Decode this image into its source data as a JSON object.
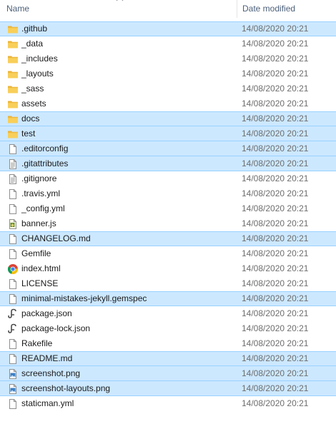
{
  "header": {
    "name_label": "Name",
    "date_label": "Date modified",
    "sort": "ascending"
  },
  "colors": {
    "selection_bg": "#cce8ff",
    "selection_border": "#99d1ff",
    "folder": "#f8c84b",
    "header_text": "#4c607a",
    "date_text": "#6d6d6d"
  },
  "files": [
    {
      "name": ".github",
      "date": "14/08/2020 20:21",
      "icon": "folder-icon",
      "selected": true
    },
    {
      "name": "_data",
      "date": "14/08/2020 20:21",
      "icon": "folder-icon",
      "selected": false
    },
    {
      "name": "_includes",
      "date": "14/08/2020 20:21",
      "icon": "folder-icon",
      "selected": false
    },
    {
      "name": "_layouts",
      "date": "14/08/2020 20:21",
      "icon": "folder-icon",
      "selected": false
    },
    {
      "name": "_sass",
      "date": "14/08/2020 20:21",
      "icon": "folder-icon",
      "selected": false
    },
    {
      "name": "assets",
      "date": "14/08/2020 20:21",
      "icon": "folder-icon",
      "selected": false
    },
    {
      "name": "docs",
      "date": "14/08/2020 20:21",
      "icon": "folder-icon",
      "selected": true
    },
    {
      "name": "test",
      "date": "14/08/2020 20:21",
      "icon": "folder-icon",
      "selected": true
    },
    {
      "name": ".editorconfig",
      "date": "14/08/2020 20:21",
      "icon": "file-icon",
      "selected": true
    },
    {
      "name": ".gitattributes",
      "date": "14/08/2020 20:21",
      "icon": "text-file-icon",
      "selected": true
    },
    {
      "name": ".gitignore",
      "date": "14/08/2020 20:21",
      "icon": "text-file-icon",
      "selected": false
    },
    {
      "name": ".travis.yml",
      "date": "14/08/2020 20:21",
      "icon": "file-icon",
      "selected": false
    },
    {
      "name": "_config.yml",
      "date": "14/08/2020 20:21",
      "icon": "file-icon",
      "selected": false
    },
    {
      "name": "banner.js",
      "date": "14/08/2020 20:21",
      "icon": "script-file-icon",
      "selected": false
    },
    {
      "name": "CHANGELOG.md",
      "date": "14/08/2020 20:21",
      "icon": "file-icon",
      "selected": true
    },
    {
      "name": "Gemfile",
      "date": "14/08/2020 20:21",
      "icon": "file-icon",
      "selected": false
    },
    {
      "name": "index.html",
      "date": "14/08/2020 20:21",
      "icon": "chrome-icon",
      "selected": false
    },
    {
      "name": "LICENSE",
      "date": "14/08/2020 20:21",
      "icon": "file-icon",
      "selected": false
    },
    {
      "name": "minimal-mistakes-jekyll.gemspec",
      "date": "14/08/2020 20:21",
      "icon": "file-icon",
      "selected": true
    },
    {
      "name": "package.json",
      "date": "14/08/2020 20:21",
      "icon": "json-file-icon",
      "selected": false
    },
    {
      "name": "package-lock.json",
      "date": "14/08/2020 20:21",
      "icon": "json-file-icon",
      "selected": false
    },
    {
      "name": "Rakefile",
      "date": "14/08/2020 20:21",
      "icon": "file-icon",
      "selected": false
    },
    {
      "name": "README.md",
      "date": "14/08/2020 20:21",
      "icon": "file-icon",
      "selected": true
    },
    {
      "name": "screenshot.png",
      "date": "14/08/2020 20:21",
      "icon": "image-file-icon",
      "selected": true
    },
    {
      "name": "screenshot-layouts.png",
      "date": "14/08/2020 20:21",
      "icon": "image-file-icon",
      "selected": true
    },
    {
      "name": "staticman.yml",
      "date": "14/08/2020 20:21",
      "icon": "file-icon",
      "selected": false
    }
  ]
}
